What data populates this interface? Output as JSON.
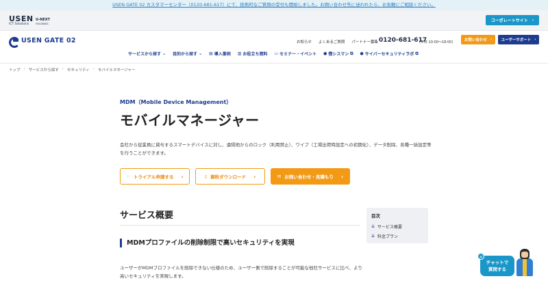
{
  "notice": {
    "text": "USEN GATE 02 カスタマーセンター（0120-681-617）にて、技術的なご質問の受付も開始しました。お問い合わせ先に迷われたら、お気軽にご相談ください。"
  },
  "topbar": {
    "usen_logo": "USEN",
    "usen_sub": "ICT Solutions",
    "unext_logo": "U-NEXT",
    "unext_sub": "HOLDINGS",
    "corporate_label": "コーポレートサイト"
  },
  "header": {
    "logo": "USEN GATE 02",
    "links": [
      "お知らせ",
      "よくあるご質問",
      "パートナー募集"
    ],
    "phone": "0120-681-617",
    "phone_hours": "(平日 10:00〜18:00)",
    "contact_label": "お問い合わせ",
    "support_label": "ユーザーサポート"
  },
  "nav": {
    "items": [
      {
        "label": "サービスから探す",
        "icon": "chevron-down-icon"
      },
      {
        "label": "目的から探す",
        "icon": "chevron-down-icon"
      },
      {
        "label": "導入事例",
        "icon": "document-icon"
      },
      {
        "label": "お役立ち資料",
        "icon": "book-icon"
      },
      {
        "label": "セミナー・イベント",
        "icon": "monitor-icon"
      },
      {
        "label": "情シスマン",
        "icon": "external-link-icon"
      },
      {
        "label": "サイバーセキュリティラボ",
        "icon": "external-link-icon"
      }
    ]
  },
  "breadcrumb": [
    "トップ",
    "サービスから探す",
    "セキュリティ",
    "モバイルマネージャー"
  ],
  "product": {
    "subtitle": "MDM（Mobile Device Management）",
    "title": "モバイルマネージャー",
    "description": "会社から従業員に貸与するスマートデバイスに対し、遠隔地からのロック（利用禁止）、ワイプ（工場出荷時設定への初期化）、データ削除、各種一括設定等を行うことができます。"
  },
  "cta": {
    "trial_label": "トライアル申請する",
    "download_label": "資料ダウンロード",
    "inquiry_label": "お問い合わせ・見積もり"
  },
  "content": {
    "section_title": "サービス概要",
    "sub_heading": "MDMプロファイルの削除制限で高いセキュリティを実現",
    "body": "ユーザーがMDMプロファイルを削除できない仕様のため、ユーザー側で削除することが可能な他社サービスに比べ、より高いセキュリティを実現します。"
  },
  "toc": {
    "title": "目次",
    "items": [
      "サービス概要",
      "料金プラン"
    ]
  },
  "chat": {
    "label_line1": "チャットで",
    "label_line2": "質問する"
  }
}
